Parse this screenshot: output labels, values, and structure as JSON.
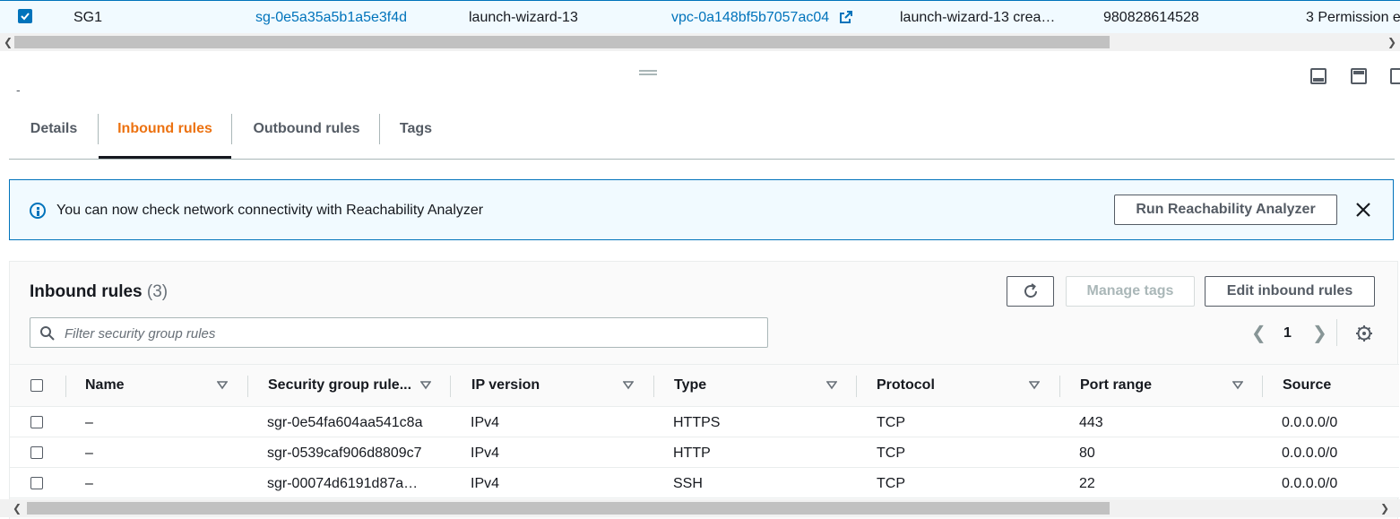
{
  "selected_row": {
    "name": "SG1",
    "security_group_id": "sg-0e5a35a5b1a5e3f4d",
    "security_group_name": "launch-wizard-13",
    "vpc_id": "vpc-0a148bf5b7057ac04",
    "description": "launch-wizard-13 crea…",
    "owner": "980828614528",
    "inbound_rules_count": "3 Permission e"
  },
  "split_panel": {
    "dash": "-"
  },
  "tabs": [
    {
      "label": "Details"
    },
    {
      "label": "Inbound rules"
    },
    {
      "label": "Outbound rules"
    },
    {
      "label": "Tags"
    }
  ],
  "flash": {
    "message": "You can now check network connectivity with Reachability Analyzer",
    "button": "Run Reachability Analyzer"
  },
  "inbound": {
    "title": "Inbound rules",
    "count": "(3)",
    "manage_tags": "Manage tags",
    "edit_button": "Edit inbound rules",
    "search_placeholder": "Filter security group rules",
    "page": "1",
    "columns": [
      "Name",
      "Security group rule...",
      "IP version",
      "Type",
      "Protocol",
      "Port range",
      "Source"
    ],
    "rows": [
      {
        "name": "–",
        "rule_id": "sgr-0e54fa604aa541c8a",
        "ip_version": "IPv4",
        "type": "HTTPS",
        "protocol": "TCP",
        "port_range": "443",
        "source": "0.0.0.0/0"
      },
      {
        "name": "–",
        "rule_id": "sgr-0539caf906d8809c7",
        "ip_version": "IPv4",
        "type": "HTTP",
        "protocol": "TCP",
        "port_range": "80",
        "source": "0.0.0.0/0"
      },
      {
        "name": "–",
        "rule_id": "sgr-00074d6191d87a…",
        "ip_version": "IPv4",
        "type": "SSH",
        "protocol": "TCP",
        "port_range": "22",
        "source": "0.0.0.0/0"
      }
    ]
  },
  "colors": {
    "accent": "#ec7211",
    "link": "#0073bb",
    "info_bg": "#f1faff"
  }
}
